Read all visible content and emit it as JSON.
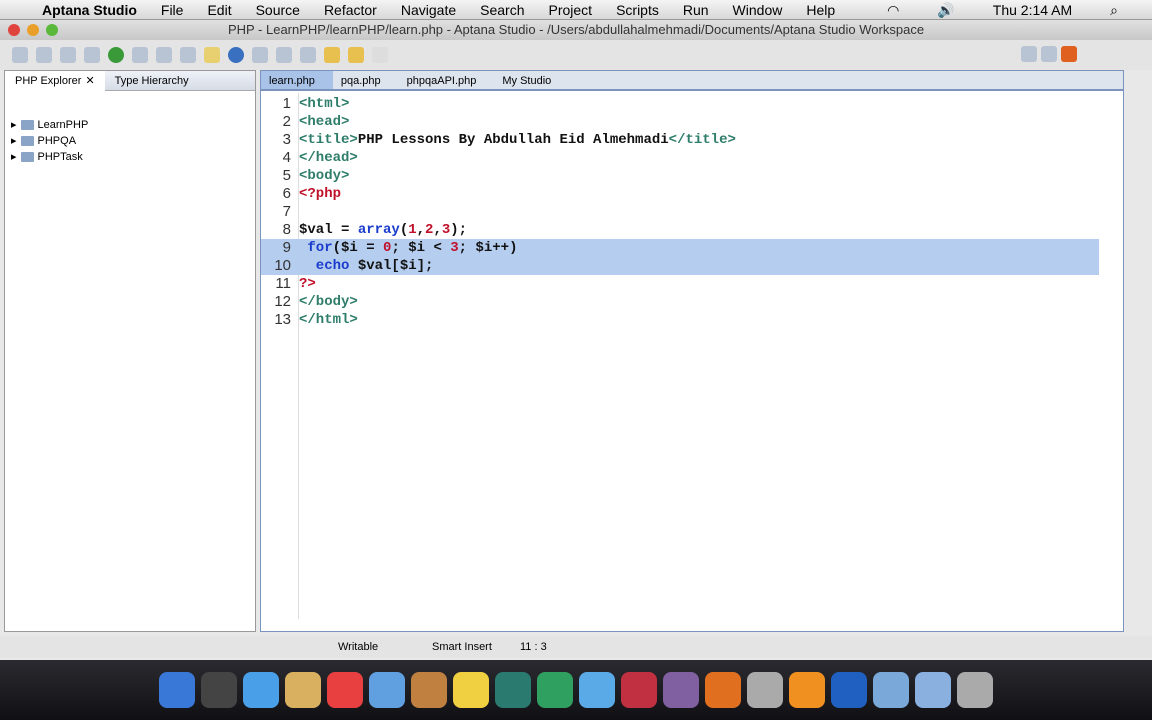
{
  "menubar": {
    "app": "Aptana Studio",
    "items": [
      "File",
      "Edit",
      "Source",
      "Refactor",
      "Navigate",
      "Search",
      "Project",
      "Scripts",
      "Run",
      "Window",
      "Help"
    ],
    "clock": "Thu 2:14 AM"
  },
  "window": {
    "title": "PHP - LearnPHP/learnPHP/learn.php - Aptana Studio - /Users/abdullahalmehmadi/Documents/Aptana Studio Workspace"
  },
  "explorer": {
    "tabs": [
      "PHP Explorer",
      "Type Hierarchy"
    ],
    "projects": [
      "LearnPHP",
      "PHPQA",
      "PHPTask"
    ]
  },
  "editor": {
    "tabs": [
      "learn.php",
      "pqa.php",
      "phpqaAPI.php",
      "My Studio"
    ],
    "lines": [
      [
        [
          "tag",
          "<html>"
        ]
      ],
      [
        [
          "tag",
          "<head>"
        ]
      ],
      [
        [
          "tag",
          "<title>"
        ],
        [
          "pl",
          "PHP Lessons By Abdullah Eid Almehmadi"
        ],
        [
          "tag",
          "</title>"
        ]
      ],
      [
        [
          "tag",
          "</head>"
        ]
      ],
      [
        [
          "tag",
          "<body>"
        ]
      ],
      [
        [
          "php",
          "<?php"
        ]
      ],
      [],
      [
        [
          "pl",
          "$val = "
        ],
        [
          "kw",
          "array"
        ],
        [
          "pl",
          "("
        ],
        [
          "num",
          "1"
        ],
        [
          "pl",
          ","
        ],
        [
          "num",
          "2"
        ],
        [
          "pl",
          ","
        ],
        [
          "num",
          "3"
        ],
        [
          "pl",
          ");"
        ]
      ],
      [
        [
          "kw",
          " for"
        ],
        [
          "pl",
          "($i = "
        ],
        [
          "num",
          "0"
        ],
        [
          "pl",
          "; $i < "
        ],
        [
          "num",
          "3"
        ],
        [
          "pl",
          "; $i++)"
        ]
      ],
      [
        [
          "kw",
          "  echo"
        ],
        [
          "pl",
          " $val[$i];"
        ]
      ],
      [
        [
          "php",
          "?>"
        ]
      ],
      [
        [
          "tag",
          "</body>"
        ]
      ],
      [
        [
          "tag",
          "</html>"
        ]
      ]
    ],
    "selected_lines": [
      9,
      10
    ]
  },
  "status": {
    "mode": "Writable",
    "insert": "Smart Insert",
    "position": "11 : 3"
  },
  "dock_colors": [
    "#3a78d8",
    "#444",
    "#4aa0e8",
    "#d8b060",
    "#e84040",
    "#60a0e0",
    "#c08040",
    "#f0d040",
    "#2a7a70",
    "#30a060",
    "#5aaae8",
    "#c03040",
    "#8060a0",
    "#e07020",
    "#aaa",
    "#f09020",
    "#2060c0",
    "#7aa8d8",
    "#8ab0e0",
    "#aaa"
  ]
}
